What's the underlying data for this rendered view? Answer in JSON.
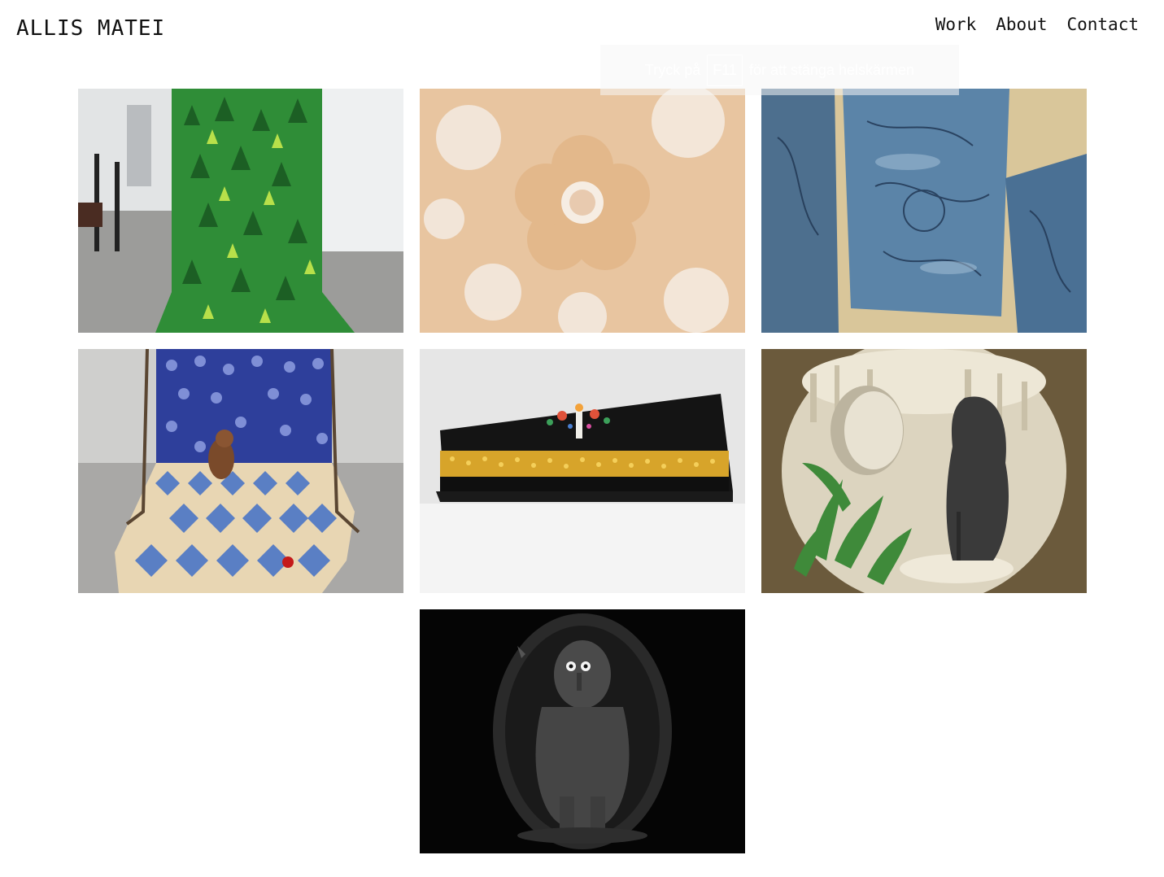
{
  "header": {
    "site_title": "ALLIS MATEI",
    "nav": [
      {
        "label": "Work"
      },
      {
        "label": "About"
      },
      {
        "label": "Contact"
      }
    ]
  },
  "fullscreen_toast": {
    "prefix": "Tryck på",
    "key": "F11",
    "suffix": "för att stänga helskärmen"
  },
  "gallery": {
    "tiles": [
      {
        "subject": "green forest-print textile runner in gallery hall"
      },
      {
        "subject": "peach flower quilted fabric close-up"
      },
      {
        "subject": "blue satin quilted panels with drawings"
      },
      {
        "subject": "blue flower and checkerboard quilt installation with dog sculpture"
      },
      {
        "subject": "black book with beaded gold edge"
      },
      {
        "subject": "white cave installation with plants and dark figure"
      },
      {
        "subject": "dark clay figure under spotlight"
      }
    ]
  },
  "colors": {
    "background": "#ffffff",
    "text": "#111111"
  }
}
